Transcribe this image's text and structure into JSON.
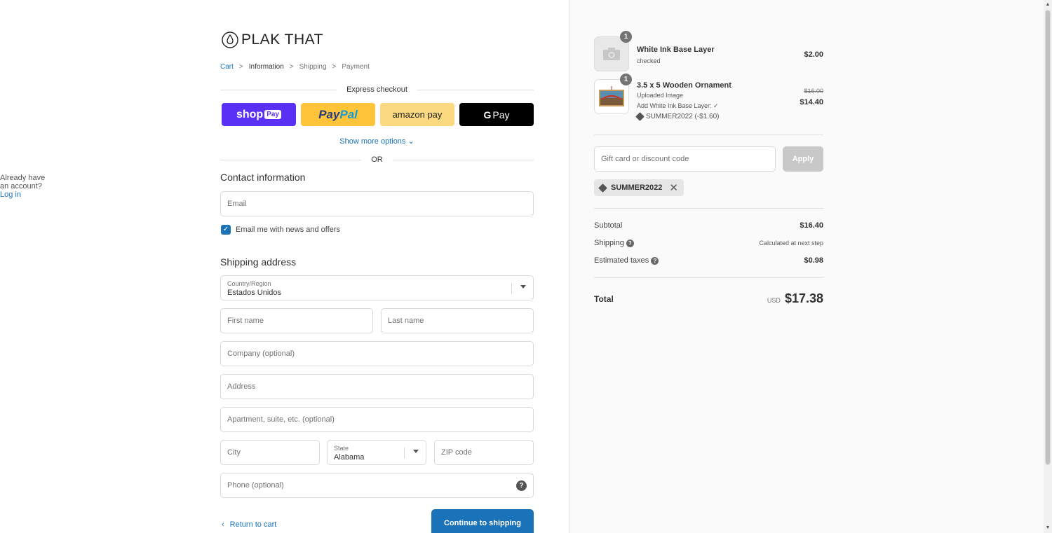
{
  "brand": {
    "name": "PLAK THAT"
  },
  "breadcrumbs": [
    {
      "label": "Cart"
    },
    {
      "label": "Information"
    },
    {
      "label": "Shipping"
    },
    {
      "label": "Payment"
    }
  ],
  "express": {
    "title": "Express checkout",
    "shop_label": "shop",
    "shop_badge": "Pay",
    "paypal_a": "Pay",
    "paypal_b": "Pal",
    "amazon_label": "amazon pay",
    "gpay_g": "G",
    "gpay_label": "Pay",
    "more_options": "Show more options",
    "or": "OR"
  },
  "contact": {
    "title": "Contact information",
    "account_prompt": "Already have an account?",
    "login": "Log in",
    "email_placeholder": "Email",
    "newsletter_label": "Email me with news and offers",
    "newsletter_checked": true
  },
  "shipping": {
    "title": "Shipping address",
    "country_label": "Country/Region",
    "country_value": "Estados Unidos",
    "first_name": "First name",
    "last_name": "Last name",
    "company": "Company (optional)",
    "address": "Address",
    "apartment": "Apartment, suite, etc. (optional)",
    "city": "City",
    "state_label": "State",
    "state_value": "Alabama",
    "zip": "ZIP code",
    "phone": "Phone (optional)"
  },
  "actions": {
    "return": "Return to cart",
    "continue": "Continue to shipping"
  },
  "order": {
    "items": [
      {
        "qty": "1",
        "name": "White Ink Base Layer",
        "sub": "checked",
        "price": "$2.00"
      },
      {
        "qty": "1",
        "name": "3.5 x 5 Wooden Ornament",
        "sub1": "Uploaded Image",
        "sub2": "Add White Ink Base Layer: ✓",
        "discount": "SUMMER2022 (-$1.60)",
        "old_price": "$16.00",
        "price": "$14.40"
      }
    ],
    "discount_placeholder": "Gift card or discount code",
    "apply": "Apply",
    "applied_code": "SUMMER2022",
    "subtotal_label": "Subtotal",
    "subtotal": "$16.40",
    "shipping_label": "Shipping",
    "shipping_value": "Calculated at next step",
    "taxes_label": "Estimated taxes",
    "taxes": "$0.98",
    "total_label": "Total",
    "currency": "USD",
    "total": "$17.38"
  }
}
